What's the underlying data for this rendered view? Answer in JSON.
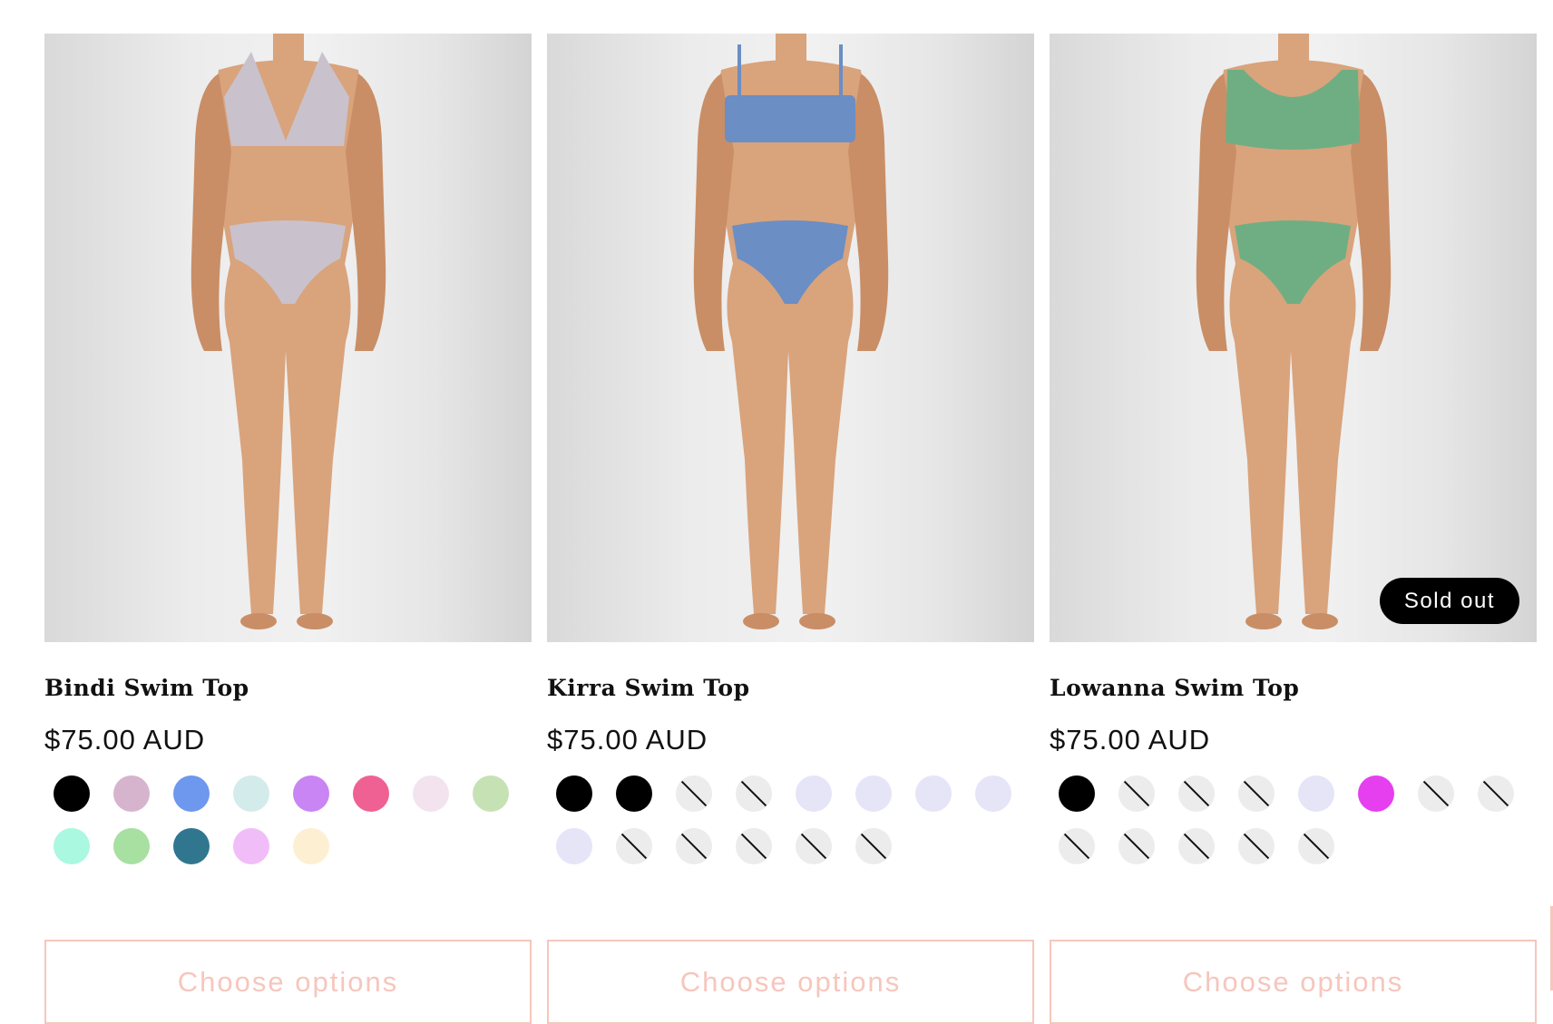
{
  "products": [
    {
      "title": "Bindi Swim Top",
      "price": "$75.00 AUD",
      "sold_out": false,
      "suit_color": "#c9c2cc",
      "top_style": "triangle",
      "cta_label": "Choose options",
      "swatches": [
        {
          "color": "#000000",
          "available": true
        },
        {
          "color": "#d6b4cd",
          "available": true
        },
        {
          "color": "#6e97ee",
          "available": true
        },
        {
          "color": "#d3ebeb",
          "available": true
        },
        {
          "color": "#c985f3",
          "available": true
        },
        {
          "color": "#ef6192",
          "available": true
        },
        {
          "color": "#f3e3ef",
          "available": true
        },
        {
          "color": "#c6e2b5",
          "available": true
        },
        {
          "color": "#a9f8df",
          "available": true
        },
        {
          "color": "#a7e0a1",
          "available": true
        },
        {
          "color": "#30768f",
          "available": true
        },
        {
          "color": "#f1bdf8",
          "available": true
        },
        {
          "color": "#fdefd1",
          "available": true
        }
      ]
    },
    {
      "title": "Kirra Swim Top",
      "price": "$75.00 AUD",
      "sold_out": false,
      "suit_color": "#6b8ec4",
      "top_style": "bandeau",
      "cta_label": "Choose options",
      "swatches": [
        {
          "color": "#000000",
          "available": true
        },
        {
          "color": "#000000",
          "available": true
        },
        {
          "color": "",
          "available": false
        },
        {
          "color": "",
          "available": false
        },
        {
          "color": "#e6e4f7",
          "available": true
        },
        {
          "color": "#e6e4f7",
          "available": true
        },
        {
          "color": "#e6e4f7",
          "available": true
        },
        {
          "color": "#e6e4f7",
          "available": true
        },
        {
          "color": "#e6e4f7",
          "available": true
        },
        {
          "color": "",
          "available": false
        },
        {
          "color": "",
          "available": false
        },
        {
          "color": "",
          "available": false
        },
        {
          "color": "",
          "available": false
        },
        {
          "color": "",
          "available": false
        }
      ]
    },
    {
      "title": "Lowanna Swim Top",
      "price": "$75.00 AUD",
      "sold_out": true,
      "badge": "Sold out",
      "suit_color": "#6fae83",
      "top_style": "scoop",
      "cta_label": "Choose options",
      "swatches": [
        {
          "color": "#000000",
          "available": true
        },
        {
          "color": "",
          "available": false
        },
        {
          "color": "",
          "available": false
        },
        {
          "color": "",
          "available": false
        },
        {
          "color": "#e6e4f7",
          "available": true
        },
        {
          "color": "#e53ff0",
          "available": true
        },
        {
          "color": "",
          "available": false
        },
        {
          "color": "",
          "available": false
        },
        {
          "color": "",
          "available": false
        },
        {
          "color": "",
          "available": false
        },
        {
          "color": "",
          "available": false
        },
        {
          "color": "",
          "available": false
        },
        {
          "color": "",
          "available": false
        }
      ]
    }
  ],
  "colors": {
    "accent_border": "#f6c6bd",
    "badge_bg": "#000000"
  }
}
